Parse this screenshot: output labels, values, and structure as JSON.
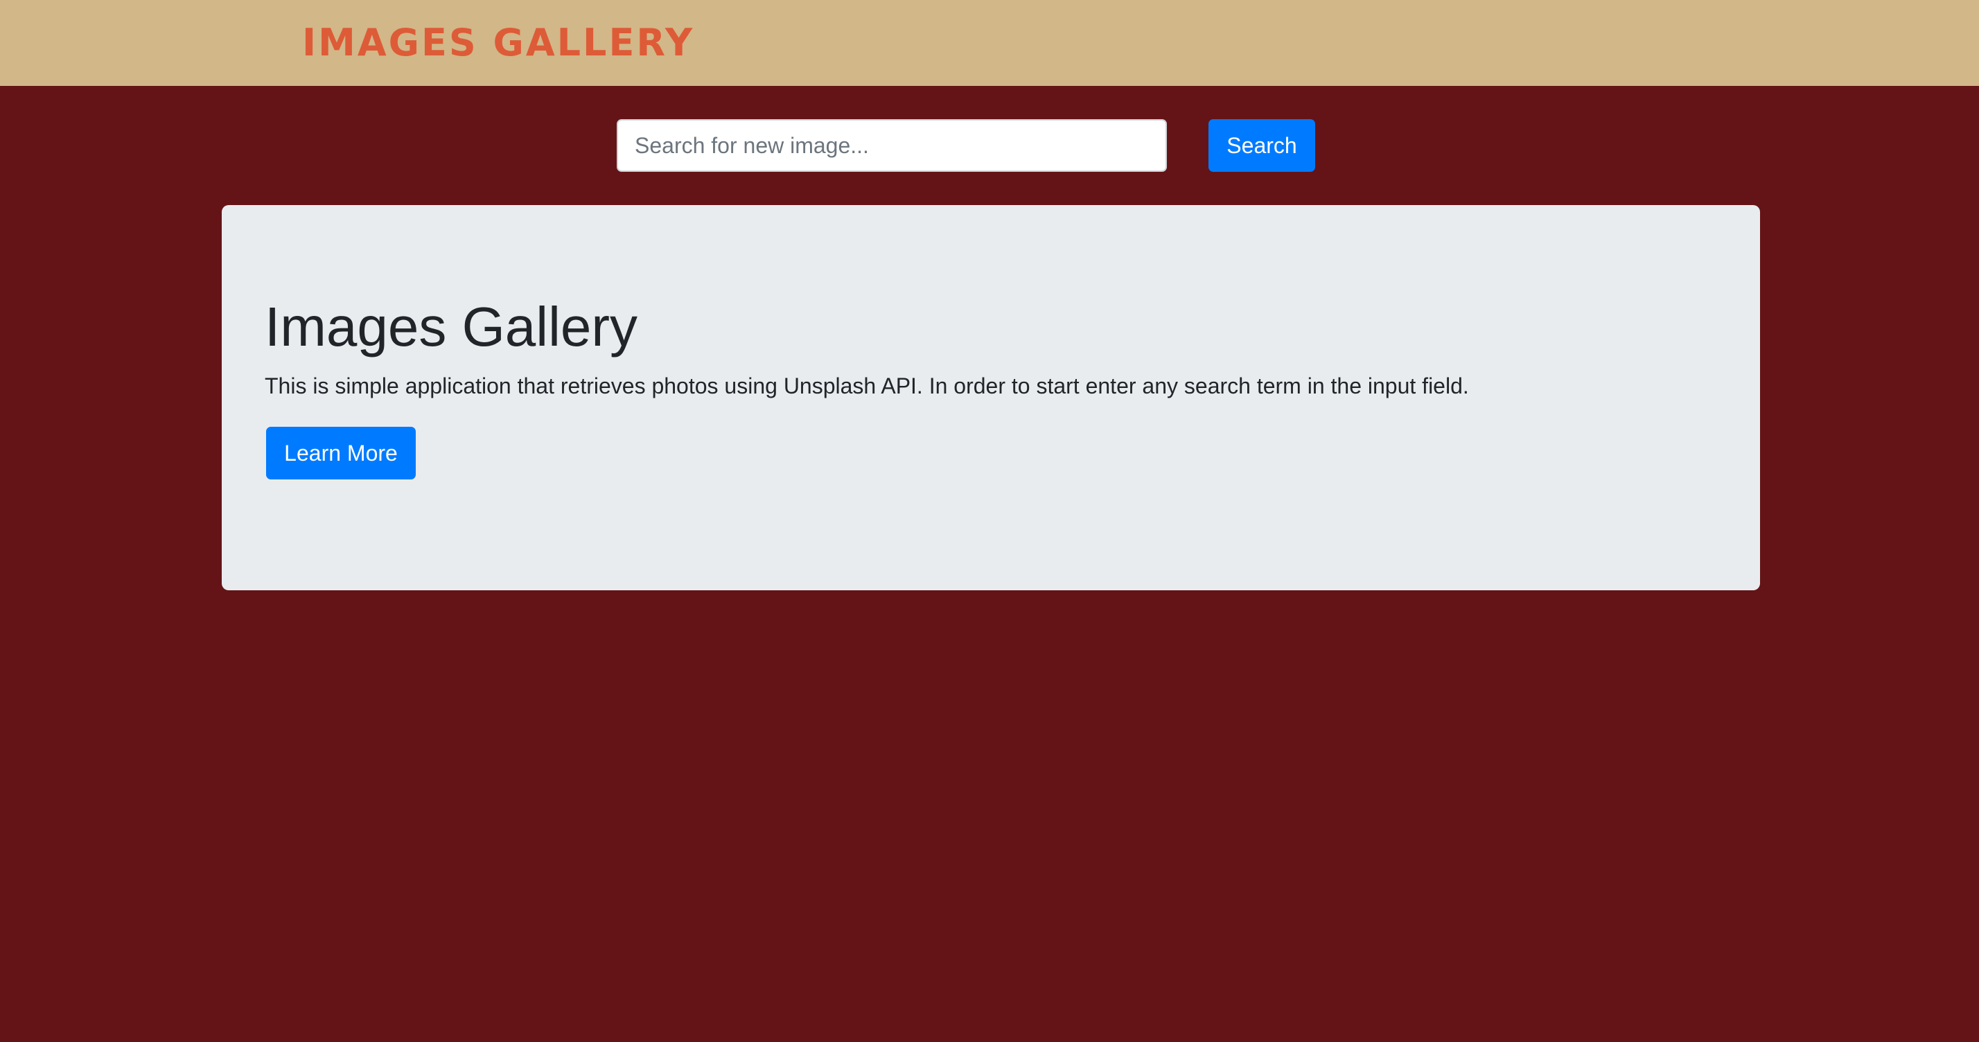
{
  "navbar": {
    "brand": "IMAGES GALLERY"
  },
  "search": {
    "placeholder": "Search for new image...",
    "value": "",
    "button_label": "Search"
  },
  "jumbotron": {
    "title": "Images Gallery",
    "description": "This is simple application that retrieves photos using Unsplash API. In order to start enter any search term in the input field.",
    "button_label": "Learn More"
  },
  "colors": {
    "page_background": "#641417",
    "navbar_background": "#d2b788",
    "brand_text": "#de5b37",
    "primary_button": "#007bff",
    "jumbotron_background": "#e9ecef"
  }
}
